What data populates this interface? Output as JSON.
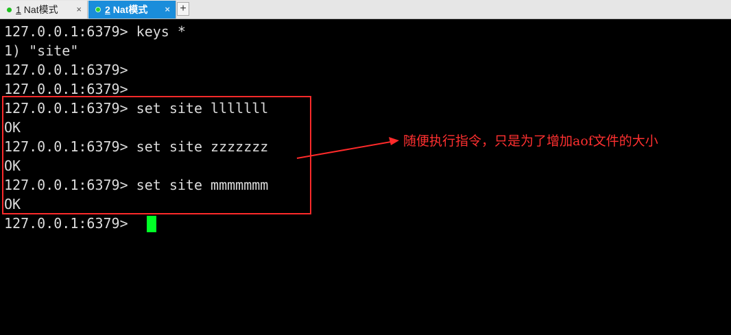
{
  "tabs": [
    {
      "number": "1",
      "label": "Nat模式",
      "close": "×"
    },
    {
      "number": "2",
      "label": "Nat模式",
      "close": "×"
    }
  ],
  "add_tab_label": "+",
  "terminal": {
    "lines": [
      "127.0.0.1:6379> keys *",
      "1) \"site\"",
      "127.0.0.1:6379>",
      "127.0.0.1:6379>",
      "127.0.0.1:6379> set site lllllll",
      "OK",
      "127.0.0.1:6379> set site zzzzzzz",
      "OK",
      "127.0.0.1:6379> set site mmmmmmm",
      "OK",
      "127.0.0.1:6379> "
    ],
    "cursor_color": "#00ff26"
  },
  "annotation": {
    "text": "随便执行指令，只是为了增加aof文件的大小",
    "color": "#ff3030"
  }
}
